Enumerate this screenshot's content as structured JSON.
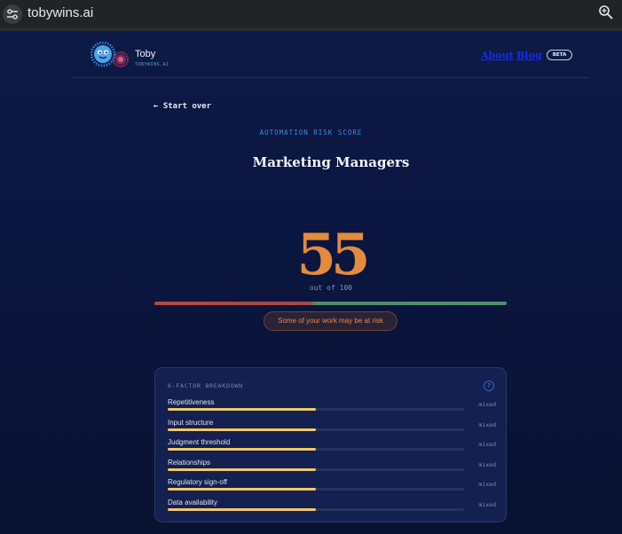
{
  "browser": {
    "url": "tobywins.ai"
  },
  "header": {
    "brand_name": "Toby",
    "brand_domain": "TOBYWINS.AI",
    "nav": {
      "about": "About",
      "blog": "Blog"
    },
    "badge": "BETA"
  },
  "result": {
    "start_over": "← Start over",
    "eyebrow": "AUTOMATION RISK SCORE",
    "job_title": "Marketing Managers",
    "score": "55",
    "score_value": 55,
    "out_of": "out of 100",
    "status": "Some of your work may be at risk"
  },
  "breakdown": {
    "title": "6-FACTOR BREAKDOWN",
    "help": "?",
    "factors": [
      {
        "name": "Repetitiveness",
        "level": 0.5,
        "label": "mixed"
      },
      {
        "name": "Input structure",
        "level": 0.5,
        "label": "mixed"
      },
      {
        "name": "Judgment threshold",
        "level": 0.5,
        "label": "mixed"
      },
      {
        "name": "Relationships",
        "level": 0.5,
        "label": "mixed"
      },
      {
        "name": "Regulatory sign-off",
        "level": 0.5,
        "label": "mixed"
      },
      {
        "name": "Data availability",
        "level": 0.5,
        "label": "mixed"
      }
    ]
  },
  "colors": {
    "background": "#0b1640",
    "score": "#e48b3c",
    "risk_high": "#b04a44",
    "risk_low": "#4f8e6e",
    "factor_fill": "#f2c967",
    "nav_link": "#1a2bff",
    "accent": "#3d8cd6"
  }
}
